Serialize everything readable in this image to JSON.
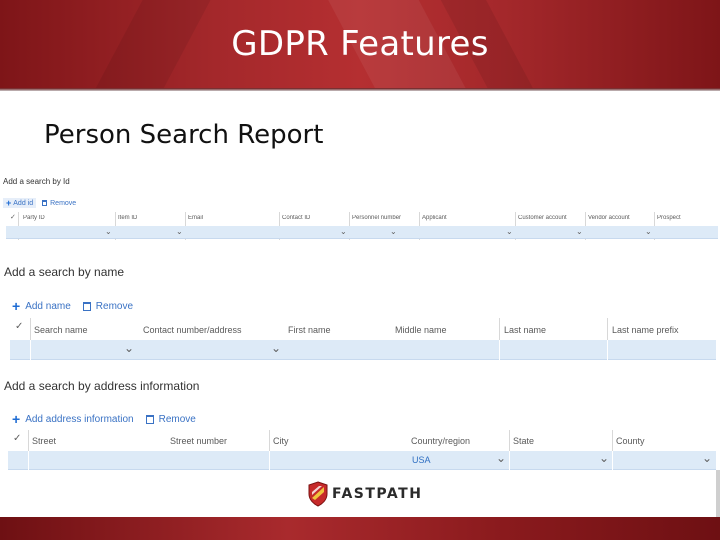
{
  "slide": {
    "title": "GDPR Features",
    "subtitle": "Person Search Report"
  },
  "section_id": {
    "title": "Add a search by Id",
    "add_label": "Add id",
    "remove_label": "Remove",
    "columns": [
      "Party ID",
      "Item ID",
      "Email",
      "Contact ID",
      "Personnel number",
      "Applicant",
      "Customer account",
      "Vendor account",
      "Prospect"
    ]
  },
  "section_name": {
    "title": "Add a search by name",
    "add_label": "Add name",
    "remove_label": "Remove",
    "columns": [
      "Search name",
      "Contact number/address",
      "First name",
      "Middle name",
      "Last name",
      "Last name prefix"
    ]
  },
  "section_address": {
    "title": "Add a search by address information",
    "add_label": "Add address information",
    "remove_label": "Remove",
    "columns": [
      "Street",
      "Street number",
      "City",
      "Country/region",
      "State",
      "County"
    ],
    "country_value": "USA"
  },
  "footer": {
    "logo_text": "FASTPATH"
  },
  "colors": {
    "header_red": "#a4282b",
    "link_blue": "#3a72c4",
    "row_fill": "#ddeaf7"
  },
  "icons": {
    "add": "plus-icon",
    "remove": "trash-icon",
    "select": "checkmark-icon",
    "dropdown": "chevron-down-icon"
  }
}
